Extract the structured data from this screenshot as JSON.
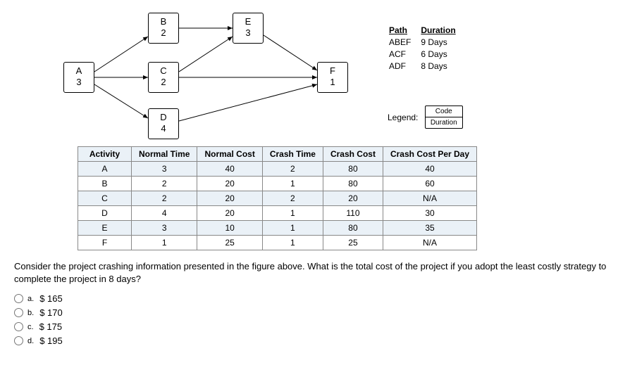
{
  "nodes": {
    "A": {
      "code": "A",
      "dur": "3"
    },
    "B": {
      "code": "B",
      "dur": "2"
    },
    "C": {
      "code": "C",
      "dur": "2"
    },
    "D": {
      "code": "D",
      "dur": "4"
    },
    "E": {
      "code": "E",
      "dur": "3"
    },
    "F": {
      "code": "F",
      "dur": "1"
    }
  },
  "paths": {
    "hdr_path": "Path",
    "hdr_dur": "Duration",
    "rows": [
      {
        "path": "ABEF",
        "dur": "9 Days"
      },
      {
        "path": "ACF",
        "dur": "6 Days"
      },
      {
        "path": "ADF",
        "dur": "8 Days"
      }
    ]
  },
  "legend": {
    "label": "Legend:",
    "code": "Code",
    "dur": "Duration"
  },
  "table": {
    "headers": {
      "activity": "Activity",
      "ntime": "Normal Time",
      "ncost": "Normal Cost",
      "ctime": "Crash Time",
      "ccost": "Crash Cost",
      "cpd": "Crash Cost Per Day"
    },
    "rows": [
      {
        "a": "A",
        "nt": "3",
        "nc": "40",
        "ct": "2",
        "cc": "80",
        "cpd": "40"
      },
      {
        "a": "B",
        "nt": "2",
        "nc": "20",
        "ct": "1",
        "cc": "80",
        "cpd": "60"
      },
      {
        "a": "C",
        "nt": "2",
        "nc": "20",
        "ct": "2",
        "cc": "20",
        "cpd": "N/A"
      },
      {
        "a": "D",
        "nt": "4",
        "nc": "20",
        "ct": "1",
        "cc": "110",
        "cpd": "30"
      },
      {
        "a": "E",
        "nt": "3",
        "nc": "10",
        "ct": "1",
        "cc": "80",
        "cpd": "35"
      },
      {
        "a": "F",
        "nt": "1",
        "nc": "25",
        "ct": "1",
        "cc": "25",
        "cpd": "N/A"
      }
    ]
  },
  "question": "Consider the project crashing information presented in the figure above. What is the total cost of the project if you adopt the least costly strategy to complete the project in 8 days?",
  "options": {
    "a": {
      "lett": "a.",
      "text": "$ 165"
    },
    "b": {
      "lett": "b.",
      "text": "$ 170"
    },
    "c": {
      "lett": "c.",
      "text": "$ 175"
    },
    "d": {
      "lett": "d.",
      "text": "$ 195"
    }
  },
  "chart_data": {
    "type": "table",
    "network": {
      "nodes": [
        {
          "id": "A",
          "duration": 3
        },
        {
          "id": "B",
          "duration": 2
        },
        {
          "id": "C",
          "duration": 2
        },
        {
          "id": "D",
          "duration": 4
        },
        {
          "id": "E",
          "duration": 3
        },
        {
          "id": "F",
          "duration": 1
        }
      ],
      "edges": [
        [
          "A",
          "B"
        ],
        [
          "A",
          "C"
        ],
        [
          "A",
          "D"
        ],
        [
          "B",
          "E"
        ],
        [
          "C",
          "E"
        ],
        [
          "C",
          "F"
        ],
        [
          "D",
          "F"
        ],
        [
          "E",
          "F"
        ]
      ],
      "paths": [
        {
          "path": "ABEF",
          "duration_days": 9
        },
        {
          "path": "ACF",
          "duration_days": 6
        },
        {
          "path": "ADF",
          "duration_days": 8
        }
      ]
    },
    "crash_table": {
      "columns": [
        "Activity",
        "Normal Time",
        "Normal Cost",
        "Crash Time",
        "Crash Cost",
        "Crash Cost Per Day"
      ],
      "rows": [
        [
          "A",
          3,
          40,
          2,
          80,
          40
        ],
        [
          "B",
          2,
          20,
          1,
          80,
          60
        ],
        [
          "C",
          2,
          20,
          2,
          20,
          null
        ],
        [
          "D",
          4,
          20,
          1,
          110,
          30
        ],
        [
          "E",
          3,
          10,
          1,
          80,
          35
        ],
        [
          "F",
          1,
          25,
          1,
          25,
          null
        ]
      ]
    }
  }
}
